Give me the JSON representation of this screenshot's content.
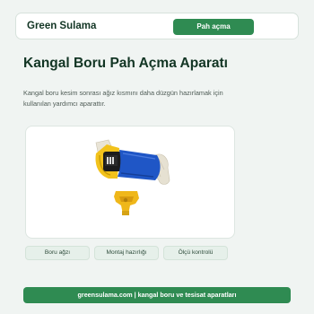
{
  "header": {
    "brand": "Green Sulama",
    "cta_label": "Pah açma"
  },
  "main": {
    "title": "Kangal Boru Pah Açma Aparatı",
    "description": "Kangal boru kesim sonrası ağız kısmını daha düzgün hazırlamak için kullanılan yardımcı aparattır."
  },
  "product_image": {
    "icon": "pipe-chamfer-tool-photo"
  },
  "chips": [
    {
      "label": "Boru ağzı"
    },
    {
      "label": "Montaj hazırlığı"
    },
    {
      "label": "Ölçü kontrolü"
    }
  ],
  "footer": {
    "text": "greensulama.com | kangal boru ve tesisat aparatları"
  },
  "colors": {
    "accent": "#2f8b52",
    "heading": "#123524",
    "background": "#f0f4f2"
  }
}
